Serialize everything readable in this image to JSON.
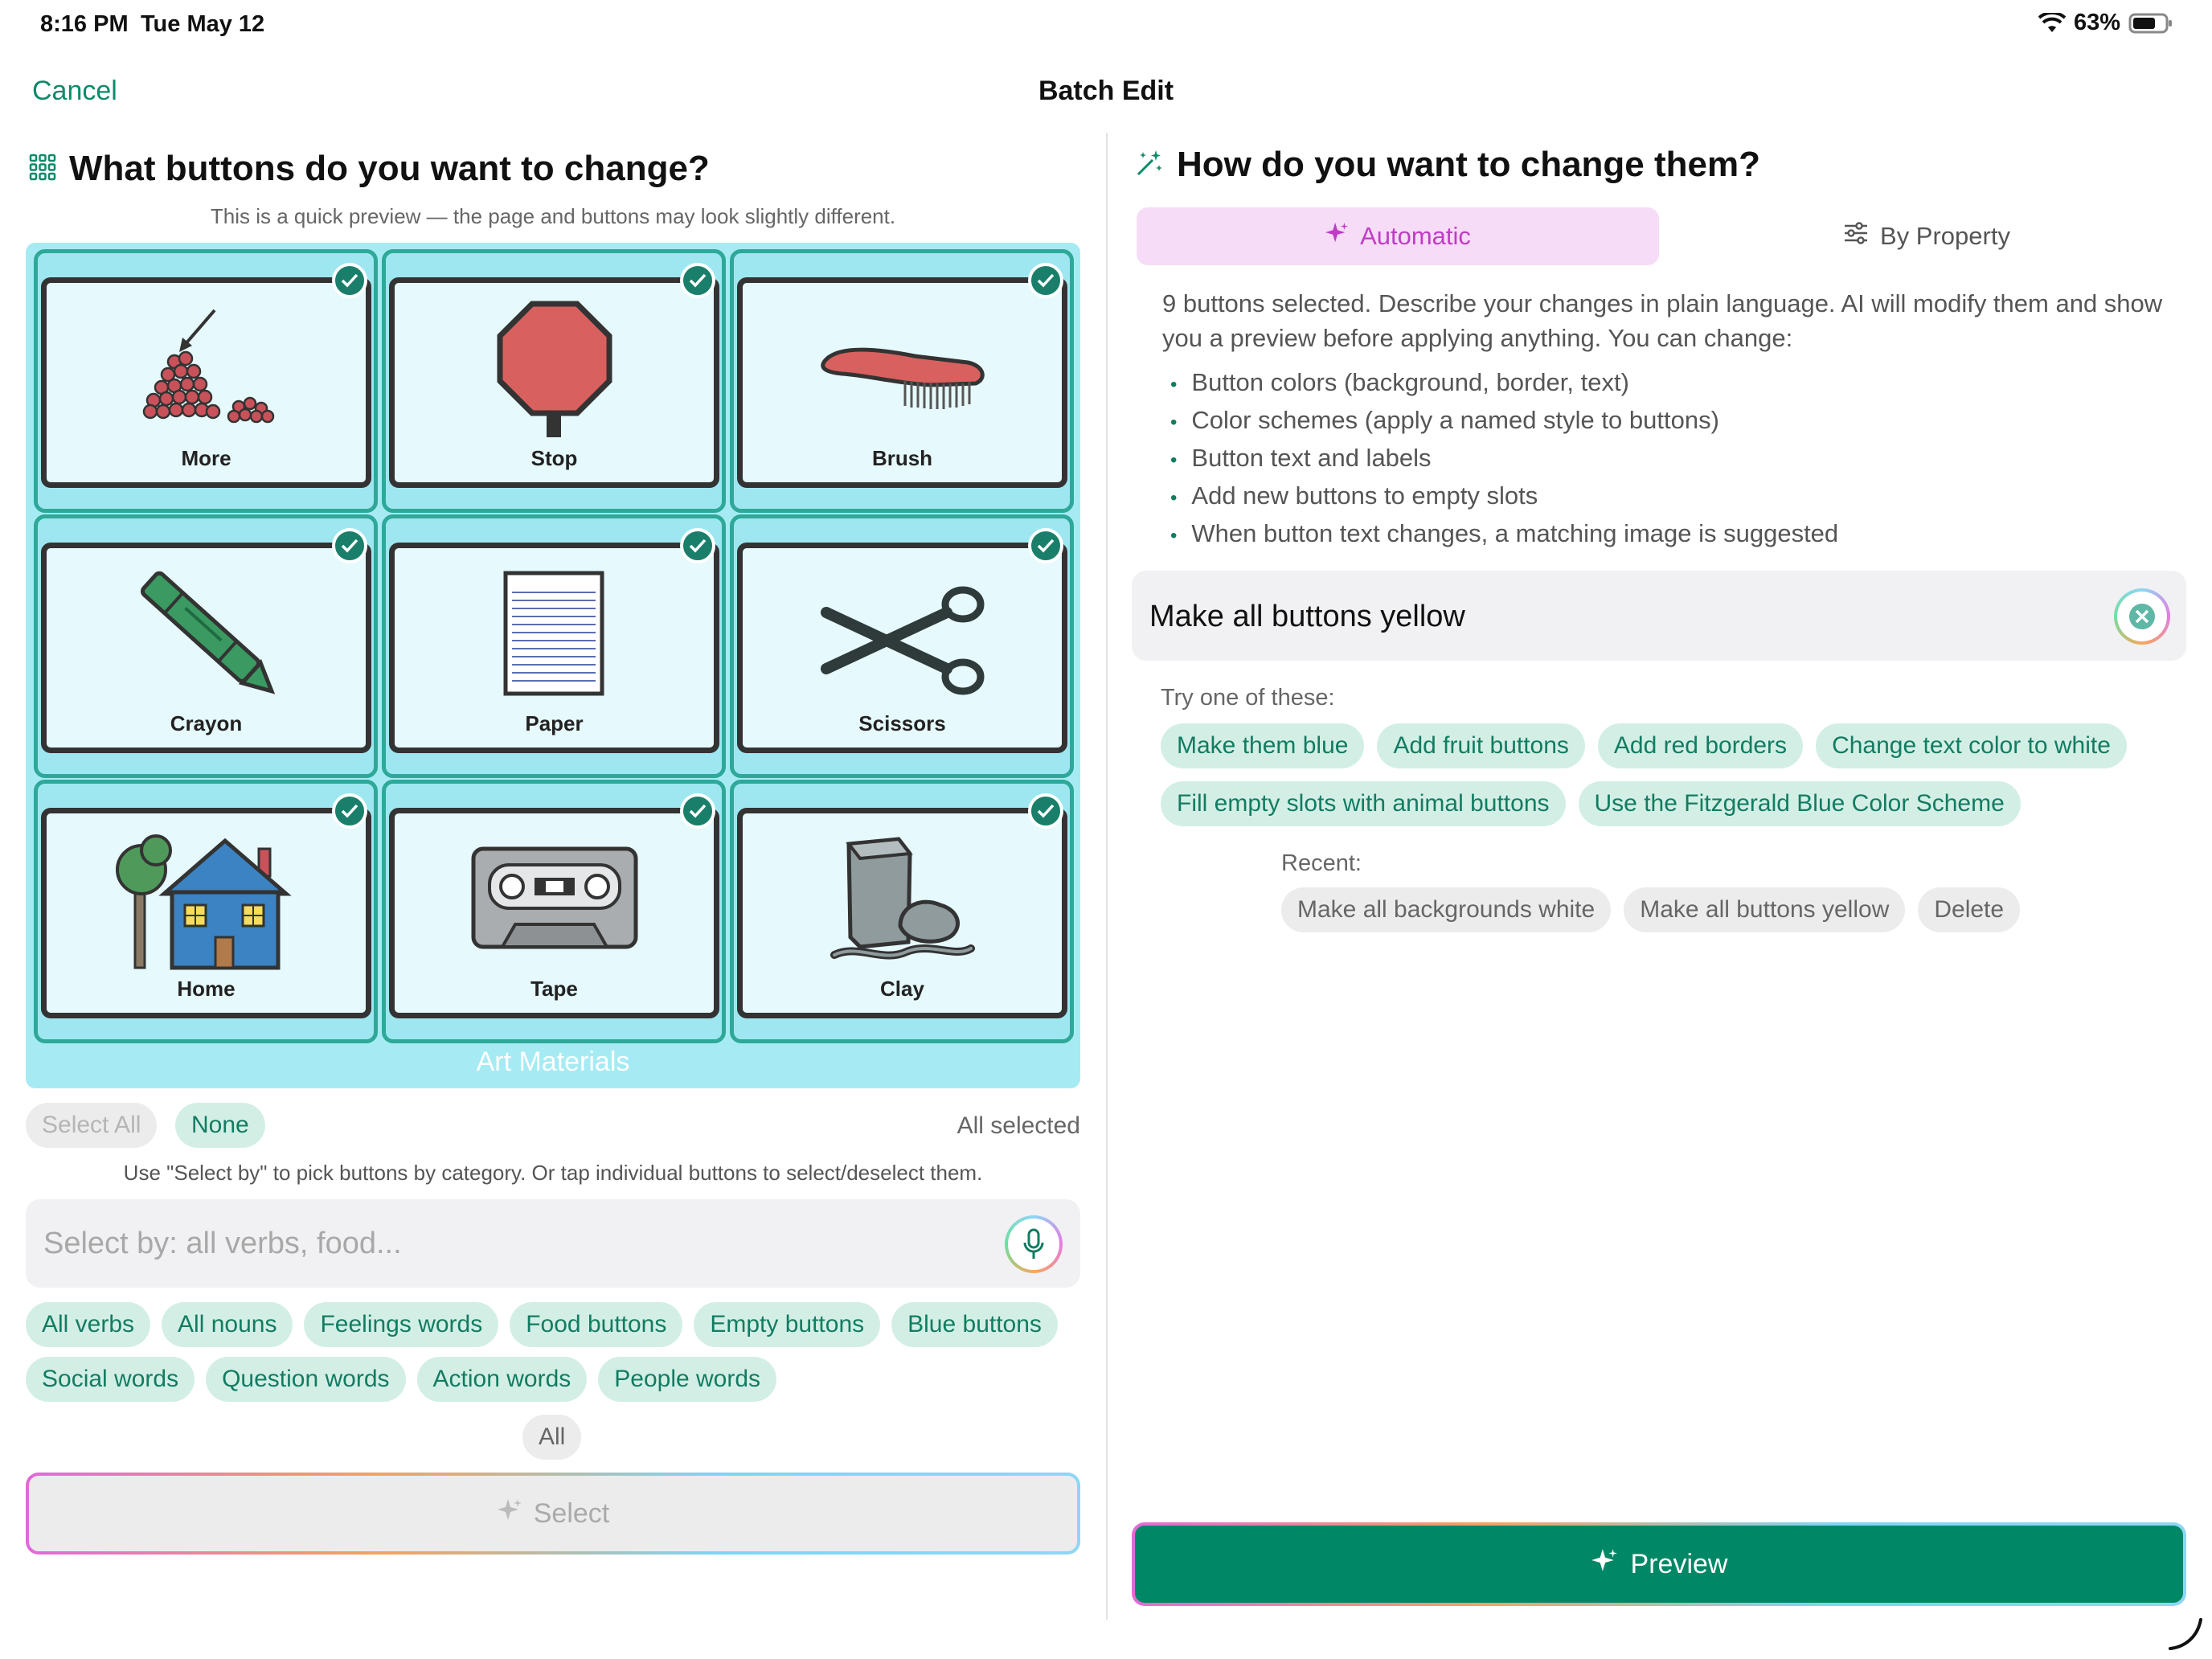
{
  "status_bar": {
    "time": "8:16 PM",
    "date": "Tue May 12",
    "battery": "63%"
  },
  "nav": {
    "cancel": "Cancel",
    "title": "Batch Edit"
  },
  "left": {
    "heading": "What buttons do you want to change?",
    "preview_note": "This is a quick preview — the page and buttons may look slightly different.",
    "grid": [
      {
        "label": "More",
        "icon": "pile-icon",
        "selected": true
      },
      {
        "label": "Stop",
        "icon": "stop-sign-icon",
        "selected": true
      },
      {
        "label": "Brush",
        "icon": "brush-icon",
        "selected": true
      },
      {
        "label": "Crayon",
        "icon": "crayon-icon",
        "selected": true
      },
      {
        "label": "Paper",
        "icon": "paper-icon",
        "selected": true
      },
      {
        "label": "Scissors",
        "icon": "scissors-icon",
        "selected": true
      },
      {
        "label": "Home",
        "icon": "house-icon",
        "selected": true
      },
      {
        "label": "Tape",
        "icon": "cassette-tape-icon",
        "selected": true
      },
      {
        "label": "Clay",
        "icon": "clay-icon",
        "selected": true
      }
    ],
    "group_label": "Art Materials",
    "select_all": "Select All",
    "none": "None",
    "all_selected": "All selected",
    "hint": "Use \"Select by\" to pick buttons by category. Or tap individual buttons to select/deselect them.",
    "select_by_placeholder": "Select by: all verbs, food...",
    "chips_row1": [
      "All verbs",
      "All nouns",
      "Feelings words",
      "Food buttons",
      "Empty buttons",
      "Blue buttons"
    ],
    "chips_row2": [
      "Social words",
      "Question words",
      "Action words",
      "People words"
    ],
    "all_chip": "All",
    "select_button": "Select"
  },
  "right": {
    "heading": "How do you want to change them?",
    "tabs": {
      "automatic": "Automatic",
      "by_property": "By Property"
    },
    "description": "9 buttons selected. Describe your changes in plain language. AI will modify them and show you a preview before applying anything. You can change:",
    "bullets": [
      "Button colors (background, border, text)",
      "Color schemes (apply a named style to buttons)",
      "Button text and labels",
      "Add new buttons to empty slots",
      "When button text changes, a matching image is suggested"
    ],
    "prompt_value": "Make all buttons yellow",
    "try_label": "Try one of these:",
    "suggestions_row1": [
      "Make them blue",
      "Add fruit buttons",
      "Add red borders",
      "Change text color to white"
    ],
    "suggestions_row2": [
      "Fill empty slots with animal buttons",
      "Use the Fitzgerald Blue Color Scheme"
    ],
    "recent_label": "Recent:",
    "recent": [
      "Make all backgrounds white",
      "Make all buttons yellow",
      "Delete"
    ],
    "preview_button": "Preview"
  },
  "colors": {
    "accent": "#0e8a6a",
    "preview_bg": "#008765",
    "grid_bg": "#a6ebf3",
    "auto_tab_bg": "#f6dcf7",
    "auto_tab_text": "#c13bc7"
  }
}
